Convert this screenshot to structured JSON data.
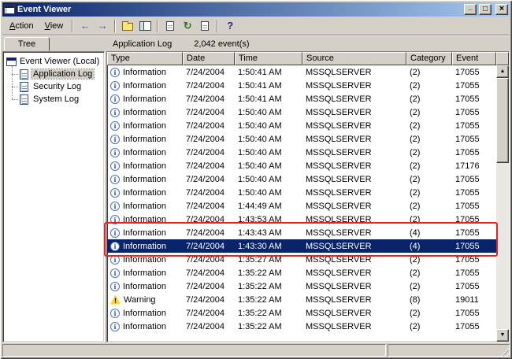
{
  "window": {
    "title": "Event Viewer"
  },
  "menubar": {
    "items": [
      "Action",
      "View"
    ]
  },
  "toolbar": {
    "icons": [
      "back",
      "forward",
      "up-one-level",
      "show-hide-console-tree",
      "properties",
      "refresh",
      "export-list",
      "help"
    ]
  },
  "tree": {
    "tab": "Tree",
    "root": "Event Viewer (Local)",
    "items": [
      {
        "label": "Application Log",
        "selected": true
      },
      {
        "label": "Security Log",
        "selected": false
      },
      {
        "label": "System Log",
        "selected": false
      }
    ]
  },
  "list": {
    "title": "Application Log",
    "count": "2,042 event(s)",
    "columns": [
      "Type",
      "Date",
      "Time",
      "Source",
      "Category",
      "Event"
    ],
    "rows": [
      {
        "type": "Information",
        "date": "7/24/2004",
        "time": "1:50:41 AM",
        "source": "MSSQLSERVER",
        "category": "(2)",
        "event": "17055",
        "selected": false
      },
      {
        "type": "Information",
        "date": "7/24/2004",
        "time": "1:50:41 AM",
        "source": "MSSQLSERVER",
        "category": "(2)",
        "event": "17055",
        "selected": false
      },
      {
        "type": "Information",
        "date": "7/24/2004",
        "time": "1:50:41 AM",
        "source": "MSSQLSERVER",
        "category": "(2)",
        "event": "17055",
        "selected": false
      },
      {
        "type": "Information",
        "date": "7/24/2004",
        "time": "1:50:40 AM",
        "source": "MSSQLSERVER",
        "category": "(2)",
        "event": "17055",
        "selected": false
      },
      {
        "type": "Information",
        "date": "7/24/2004",
        "time": "1:50:40 AM",
        "source": "MSSQLSERVER",
        "category": "(2)",
        "event": "17055",
        "selected": false
      },
      {
        "type": "Information",
        "date": "7/24/2004",
        "time": "1:50:40 AM",
        "source": "MSSQLSERVER",
        "category": "(2)",
        "event": "17055",
        "selected": false
      },
      {
        "type": "Information",
        "date": "7/24/2004",
        "time": "1:50:40 AM",
        "source": "MSSQLSERVER",
        "category": "(2)",
        "event": "17055",
        "selected": false
      },
      {
        "type": "Information",
        "date": "7/24/2004",
        "time": "1:50:40 AM",
        "source": "MSSQLSERVER",
        "category": "(2)",
        "event": "17176",
        "selected": false
      },
      {
        "type": "Information",
        "date": "7/24/2004",
        "time": "1:50:40 AM",
        "source": "MSSQLSERVER",
        "category": "(2)",
        "event": "17055",
        "selected": false
      },
      {
        "type": "Information",
        "date": "7/24/2004",
        "time": "1:50:40 AM",
        "source": "MSSQLSERVER",
        "category": "(2)",
        "event": "17055",
        "selected": false
      },
      {
        "type": "Information",
        "date": "7/24/2004",
        "time": "1:44:49 AM",
        "source": "MSSQLSERVER",
        "category": "(2)",
        "event": "17055",
        "selected": false
      },
      {
        "type": "Information",
        "date": "7/24/2004",
        "time": "1:43:53 AM",
        "source": "MSSQLSERVER",
        "category": "(2)",
        "event": "17055",
        "selected": false
      },
      {
        "type": "Information",
        "date": "7/24/2004",
        "time": "1:43:43 AM",
        "source": "MSSQLSERVER",
        "category": "(4)",
        "event": "17055",
        "selected": false
      },
      {
        "type": "Information",
        "date": "7/24/2004",
        "time": "1:43:30 AM",
        "source": "MSSQLSERVER",
        "category": "(4)",
        "event": "17055",
        "selected": true
      },
      {
        "type": "Information",
        "date": "7/24/2004",
        "time": "1:35:27 AM",
        "source": "MSSQLSERVER",
        "category": "(2)",
        "event": "17055",
        "selected": false
      },
      {
        "type": "Information",
        "date": "7/24/2004",
        "time": "1:35:22 AM",
        "source": "MSSQLSERVER",
        "category": "(2)",
        "event": "17055",
        "selected": false
      },
      {
        "type": "Information",
        "date": "7/24/2004",
        "time": "1:35:22 AM",
        "source": "MSSQLSERVER",
        "category": "(2)",
        "event": "17055",
        "selected": false
      },
      {
        "type": "Warning",
        "date": "7/24/2004",
        "time": "1:35:22 AM",
        "source": "MSSQLSERVER",
        "category": "(8)",
        "event": "19011",
        "selected": false
      },
      {
        "type": "Information",
        "date": "7/24/2004",
        "time": "1:35:22 AM",
        "source": "MSSQLSERVER",
        "category": "(2)",
        "event": "17055",
        "selected": false
      },
      {
        "type": "Information",
        "date": "7/24/2004",
        "time": "1:35:22 AM",
        "source": "MSSQLSERVER",
        "category": "(2)",
        "event": "17055",
        "selected": false
      }
    ]
  },
  "colors": {
    "titlebar_start": "#0a246a",
    "titlebar_end": "#a6caf0",
    "selection": "#0a246a",
    "chrome": "#d4d0c8",
    "annotation_red": "#e42222"
  }
}
